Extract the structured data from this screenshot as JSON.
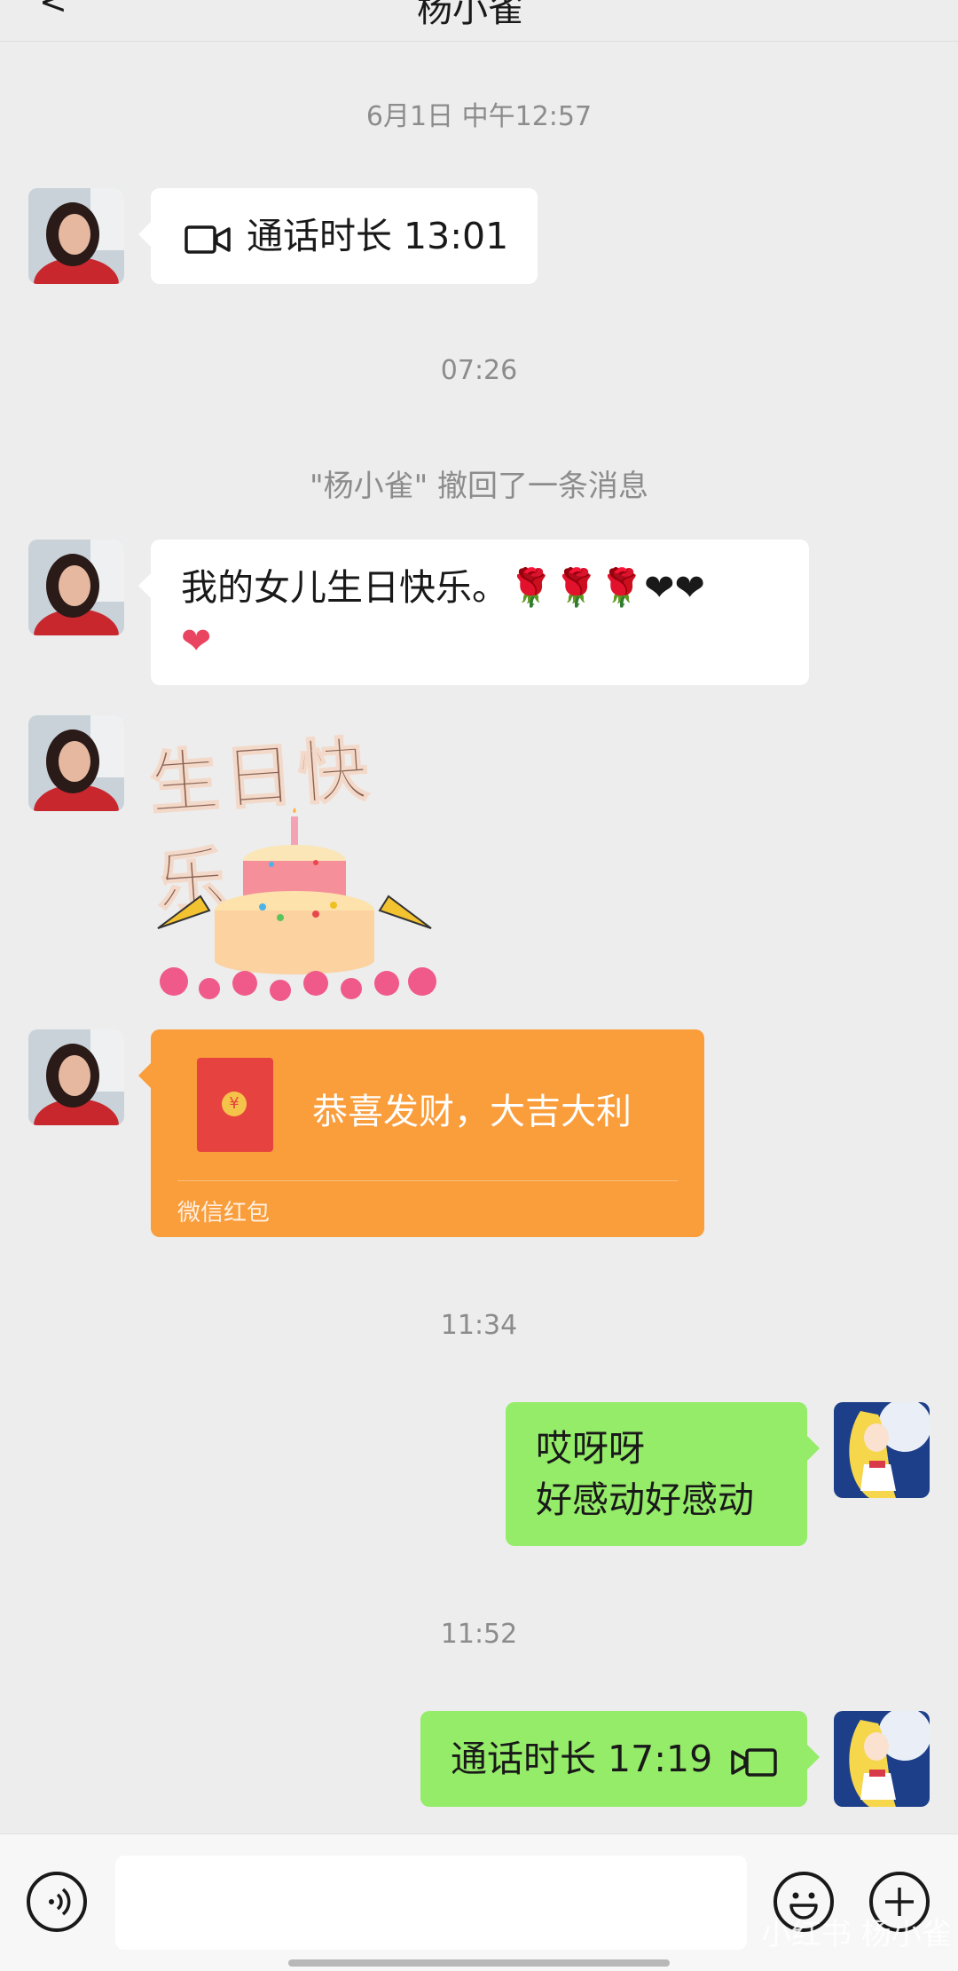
{
  "header": {
    "title_partial": "杨小雀",
    "back_partial": "<"
  },
  "timestamps": [
    "6月1日 中午12:57",
    "07:26",
    "11:34",
    "11:52"
  ],
  "messages": {
    "call1": "通话时长 13:01",
    "recall_notice": "\"杨小雀\" 撤回了一条消息",
    "birthday_line1": "我的女儿生日快乐。🌹🌹🌹❤❤",
    "birthday_line2": "❤",
    "sticker_text": "生日快乐",
    "redpacket_text": "恭喜发财，大吉大利",
    "redpacket_label": "微信红包",
    "redpacket_symbol": "¥",
    "reply_line1": "哎呀呀",
    "reply_line2": "好感动好感动",
    "call2": "通话时长 17:19"
  },
  "watermark": "小红书 杨小雀",
  "colors": {
    "background": "#ededed",
    "bubble_self": "#95ec69",
    "bubble_other": "#ffffff",
    "red_packet": "#fa9d3b",
    "timestamp": "#8c8c8c"
  },
  "icons": [
    "video-call-icon",
    "voice-input-icon",
    "emoji-icon",
    "plus-icon",
    "red-packet-icon"
  ]
}
